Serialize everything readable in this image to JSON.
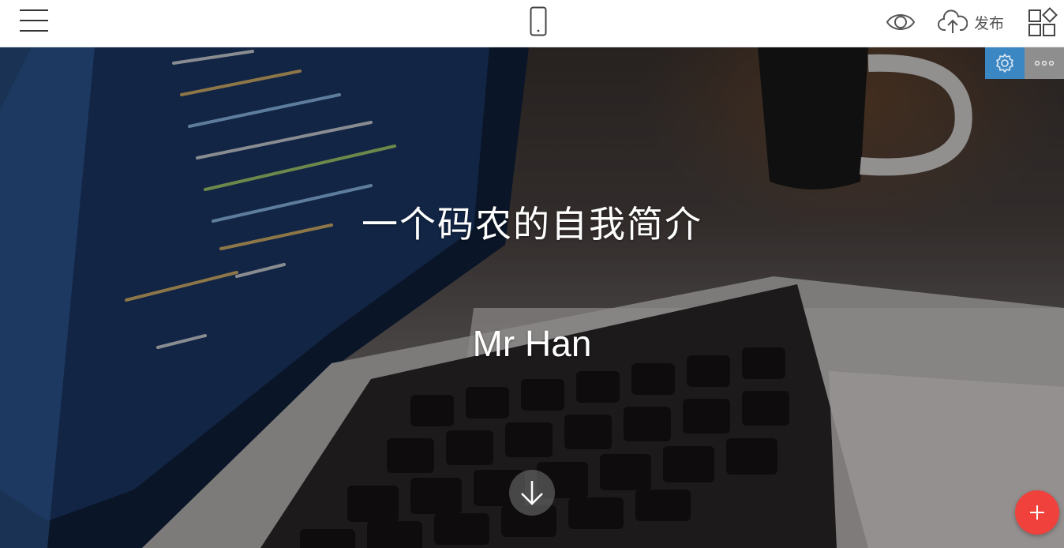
{
  "topbar": {
    "menu_icon": "hamburger-menu-icon",
    "device_icon": "mobile-phone-icon",
    "preview_icon": "eye-icon",
    "publish_icon": "cloud-upload-icon",
    "publish_label": "发布",
    "blocks_icon": "blocks-icon"
  },
  "hero": {
    "title": "一个码农的自我简介",
    "subtitle": "Mr Han",
    "scroll_icon": "arrow-down-icon",
    "background_description": "laptop-with-code-photo"
  },
  "block_toolbar": {
    "settings_icon": "gear-icon",
    "more_icon": "more-dots-icon"
  },
  "fab": {
    "icon": "plus-icon"
  },
  "colors": {
    "accent_blue": "#3b87c4",
    "fab_red": "#f0413c",
    "topbar_bg": "#ffffff",
    "icon_gray": "#555555"
  }
}
